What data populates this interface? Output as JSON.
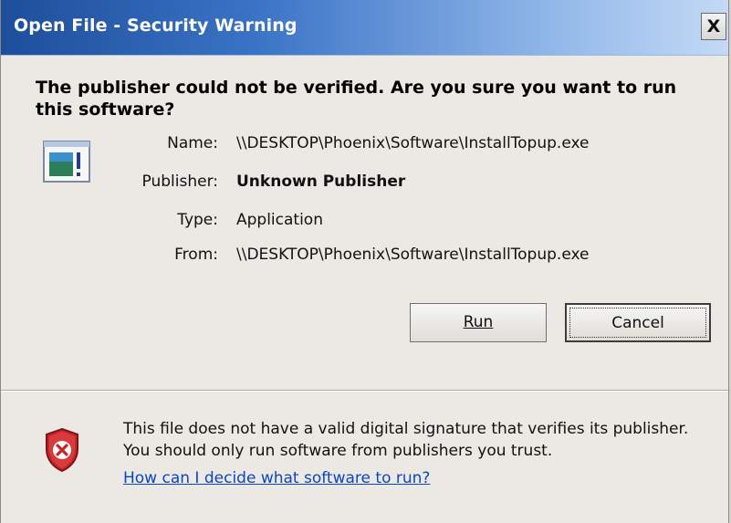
{
  "window": {
    "title": "Open File - Security Warning",
    "close_label": "X"
  },
  "heading": "The publisher could not be verified.  Are you sure you want to run this software?",
  "details": {
    "name_label": "Name:",
    "name_value": "\\\\DESKTOP\\Phoenix\\Software\\InstallTopup.exe",
    "publisher_label": "Publisher:",
    "publisher_value": "Unknown Publisher",
    "type_label": "Type:",
    "type_value": "Application",
    "from_label": "From:",
    "from_value": "\\\\DESKTOP\\Phoenix\\Software\\InstallTopup.exe"
  },
  "buttons": {
    "run_label": "Run",
    "cancel_label": "Cancel"
  },
  "warning": {
    "text": "This file does not have a valid digital signature that verifies its publisher.  You should only run software from publishers you trust.",
    "link_text": "How can I decide what software to run?"
  },
  "icons": {
    "file": "application-file-icon",
    "shield": "security-shield-error-icon"
  },
  "colors": {
    "title_start": "#1d4e9a",
    "title_end": "#c4daf6",
    "link": "#0a45c9",
    "shield_red": "#c8272a"
  }
}
